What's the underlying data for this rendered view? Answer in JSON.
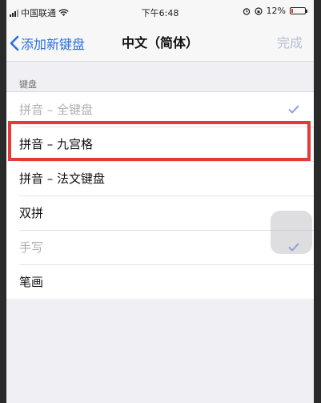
{
  "status_bar": {
    "carrier": "中国联通",
    "time": "下午6:48",
    "battery": "12%",
    "battery_level": 0.12
  },
  "nav": {
    "back_label": "添加新键盘",
    "title": "中文（简体）",
    "done_label": "完成"
  },
  "section": {
    "header": "键盘",
    "items": [
      {
        "label": "拼音 – 全键盘",
        "checked": true,
        "dim": true
      },
      {
        "label": "拼音 – 九宫格",
        "checked": false,
        "dim": false
      },
      {
        "label": "拼音 – 法文键盘",
        "checked": false,
        "dim": false
      },
      {
        "label": "双拼",
        "checked": false,
        "dim": false
      },
      {
        "label": "手写",
        "checked": true,
        "dim": true
      },
      {
        "label": "笔画",
        "checked": false,
        "dim": false
      }
    ]
  },
  "colors": {
    "accent": "#2a6fe0",
    "highlight": "#e53a3a",
    "disabled": "#b7bfd0"
  }
}
